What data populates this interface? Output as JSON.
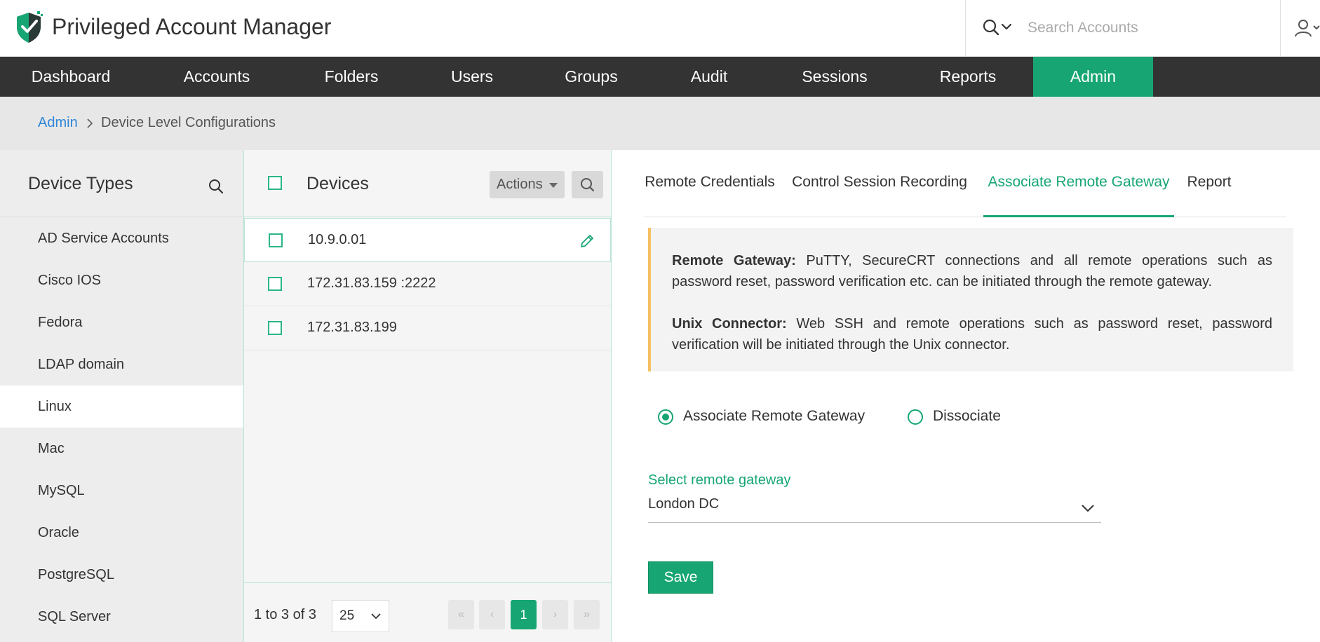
{
  "app": {
    "title": "Privileged Account Manager"
  },
  "search": {
    "placeholder": "Search Accounts"
  },
  "nav": {
    "items": [
      {
        "label": "Dashboard"
      },
      {
        "label": "Accounts"
      },
      {
        "label": "Folders"
      },
      {
        "label": "Users"
      },
      {
        "label": "Groups"
      },
      {
        "label": "Audit"
      },
      {
        "label": "Sessions"
      },
      {
        "label": "Reports"
      },
      {
        "label": "Admin",
        "active": true
      }
    ]
  },
  "breadcrumb": {
    "root": "Admin",
    "current": "Device Level Configurations"
  },
  "device_types": {
    "title": "Device Types",
    "items": [
      {
        "label": "AD Service Accounts"
      },
      {
        "label": "Cisco IOS"
      },
      {
        "label": "Fedora"
      },
      {
        "label": "LDAP domain"
      },
      {
        "label": "Linux",
        "active": true
      },
      {
        "label": "Mac"
      },
      {
        "label": "MySQL"
      },
      {
        "label": "Oracle"
      },
      {
        "label": "PostgreSQL"
      },
      {
        "label": "SQL Server"
      }
    ]
  },
  "devices": {
    "title": "Devices",
    "actions_label": "Actions",
    "rows": [
      {
        "label": "10.9.0.01",
        "active": true
      },
      {
        "label": "172.31.83.159 :2222"
      },
      {
        "label": "172.31.83.199"
      }
    ],
    "pagination": {
      "info": "1 to 3 of 3",
      "per_page": "25",
      "first": "«",
      "prev": "‹",
      "current": "1",
      "next": "›",
      "last": "»"
    }
  },
  "tabs": [
    {
      "label": "Remote Credentials"
    },
    {
      "label": "Control Session Recording"
    },
    {
      "label": "Associate Remote Gateway",
      "active": true
    },
    {
      "label": "Report"
    }
  ],
  "info": {
    "gateway_title": "Remote Gateway:",
    "gateway_text": " PuTTY, SecureCRT connections and all remote operations such as password reset, password verification etc. can be initiated through the remote gateway.",
    "connector_title": "Unix Connector:",
    "connector_text": " Web SSH and remote operations such as password reset, password verification will be initiated through the Unix connector."
  },
  "radios": {
    "associate": "Associate Remote Gateway",
    "dissociate": "Dissociate",
    "selected": "associate"
  },
  "gateway_select": {
    "label": "Select remote gateway",
    "value": "London DC"
  },
  "save_label": "Save",
  "colors": {
    "brand": "#17a673",
    "nav_bg": "#333333",
    "link": "#2f86d8",
    "info_border": "#f5c060"
  },
  "icons": {
    "logo": "shield-check-logo",
    "search": "search-icon",
    "user": "user-icon",
    "edit": "pencil-icon",
    "chevron": "chevron-down-icon"
  }
}
